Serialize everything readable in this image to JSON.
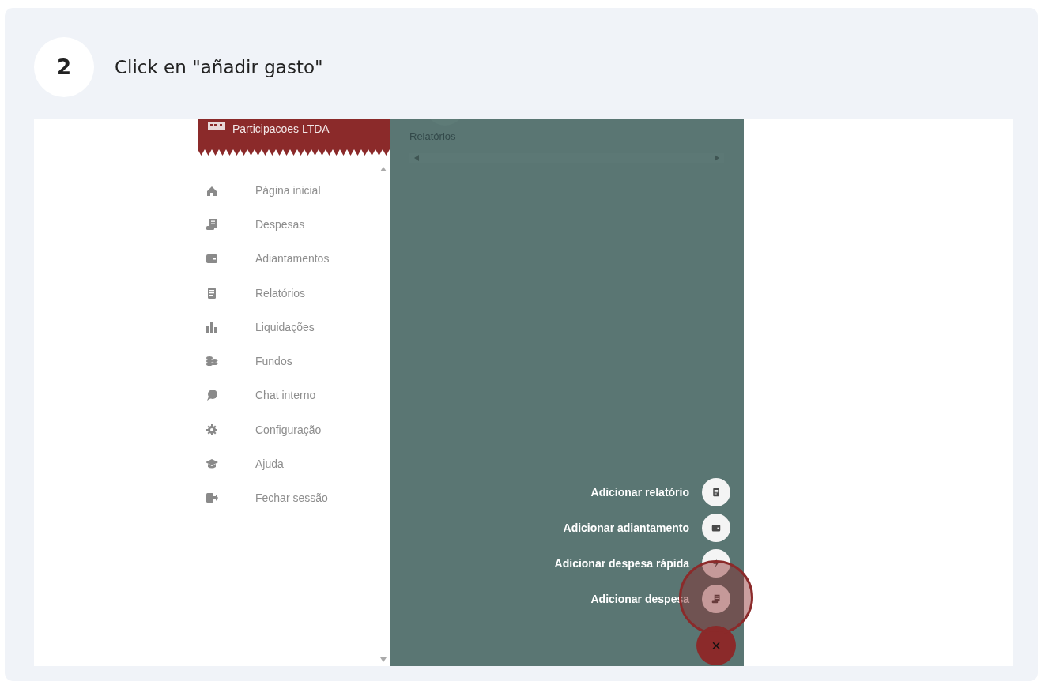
{
  "step": {
    "number": "2",
    "instruction": "Click en \"añadir gasto\""
  },
  "sidebar": {
    "company": "Participacoes LTDA",
    "items": [
      {
        "label": "Página inicial",
        "kind": "home"
      },
      {
        "label": "Despesas",
        "kind": "receipt"
      },
      {
        "label": "Adiantamentos",
        "kind": "wallet"
      },
      {
        "label": "Relatórios",
        "kind": "report"
      },
      {
        "label": "Liquidações",
        "kind": "bars"
      },
      {
        "label": "Fundos",
        "kind": "coins"
      },
      {
        "label": "Chat interno",
        "kind": "chat"
      },
      {
        "label": "Configuração",
        "kind": "gear"
      },
      {
        "label": "Ajuda",
        "kind": "cap"
      },
      {
        "label": "Fechar sessão",
        "kind": "exit"
      }
    ]
  },
  "content": {
    "shortcut_label": "Relatórios"
  },
  "fab_actions": [
    {
      "label": "Adicionar relatório",
      "kind": "report",
      "highlighted": false
    },
    {
      "label": "Adicionar adiantamento",
      "kind": "wallet",
      "highlighted": false
    },
    {
      "label": "Adicionar despesa rápida",
      "kind": "bolt",
      "highlighted": false
    },
    {
      "label": "Adicionar despesa",
      "kind": "receipt",
      "highlighted": true
    }
  ],
  "fab_close": "×"
}
